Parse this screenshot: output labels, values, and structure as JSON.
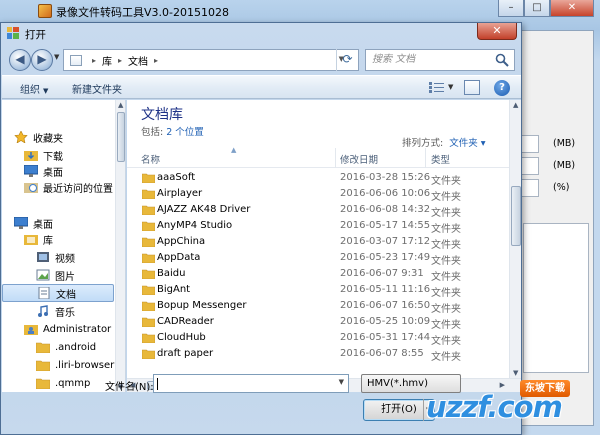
{
  "app": {
    "title": "录像文件转码工具V3.0-20151028",
    "window_controls": {
      "minimize": "–",
      "maximize": "□",
      "close": "✕"
    }
  },
  "bg_panel": {
    "units": [
      "(MB)",
      "(MB)",
      "(%)"
    ]
  },
  "dialog": {
    "title": "打开",
    "close": "✕",
    "address": {
      "crumbs": [
        "库",
        "文档"
      ],
      "separator": "▸"
    },
    "search": {
      "placeholder": "搜索 文档"
    },
    "toolbar": {
      "organize": "组织",
      "new_folder": "新建文件夹"
    },
    "nav": {
      "items": [
        {
          "label": "收藏夹",
          "icon": "star-icon"
        },
        {
          "label": "下载",
          "icon": "download-folder-icon"
        },
        {
          "label": "桌面",
          "icon": "desktop-icon"
        },
        {
          "label": "最近访问的位置",
          "icon": "recent-places-icon"
        },
        {
          "label": "桌面",
          "icon": "desktop-icon"
        },
        {
          "label": "库",
          "icon": "library-icon"
        },
        {
          "label": "视频",
          "icon": "video-icon"
        },
        {
          "label": "图片",
          "icon": "pictures-icon"
        },
        {
          "label": "文档",
          "icon": "documents-icon"
        },
        {
          "label": "音乐",
          "icon": "music-icon"
        },
        {
          "label": "Administrator",
          "icon": "user-folder-icon"
        },
        {
          "label": ".android",
          "icon": "folder-icon"
        },
        {
          "label": ".liri-browser",
          "icon": "folder-icon"
        },
        {
          "label": ".qmmp",
          "icon": "folder-icon"
        }
      ],
      "selected_index": 8
    },
    "content": {
      "library_title": "文档库",
      "includes_label": "包括:",
      "includes_link": "2 个位置",
      "arrange_label": "排列方式:",
      "arrange_value": "文件夹",
      "columns": {
        "name": "名称",
        "date": "修改日期",
        "type": "类型"
      },
      "files": [
        {
          "name": "aaaSoft",
          "date": "2016-03-28 15:26",
          "type": "文件夹"
        },
        {
          "name": "Airplayer",
          "date": "2016-06-06 10:06",
          "type": "文件夹"
        },
        {
          "name": "AJAZZ AK48 Driver",
          "date": "2016-06-08 14:32",
          "type": "文件夹"
        },
        {
          "name": "AnyMP4 Studio",
          "date": "2016-05-17 14:55",
          "type": "文件夹"
        },
        {
          "name": "AppChina",
          "date": "2016-03-07 17:12",
          "type": "文件夹"
        },
        {
          "name": "AppData",
          "date": "2016-05-23 17:49",
          "type": "文件夹"
        },
        {
          "name": "Baidu",
          "date": "2016-06-07 9:31",
          "type": "文件夹"
        },
        {
          "name": "BigAnt",
          "date": "2016-05-11 11:16",
          "type": "文件夹"
        },
        {
          "name": "Bopup Messenger",
          "date": "2016-06-07 16:50",
          "type": "文件夹"
        },
        {
          "name": "CADReader",
          "date": "2016-05-25 10:09",
          "type": "文件夹"
        },
        {
          "name": "CloudHub",
          "date": "2016-05-31 17:44",
          "type": "文件夹"
        },
        {
          "name": "draft paper",
          "date": "2016-06-07 8:55",
          "type": "文件夹"
        }
      ]
    },
    "bottom": {
      "filename_label": "文件名(N):",
      "filename_value": "",
      "filter": "HMV(*.hmv)",
      "open_button": "打开(O)"
    }
  },
  "watermark": {
    "text": "uzzf.com",
    "badge": "东坡下载"
  },
  "colors": {
    "accent": "#1e5fb3",
    "library_title": "#1e3287",
    "folder": "#e8b83a"
  }
}
